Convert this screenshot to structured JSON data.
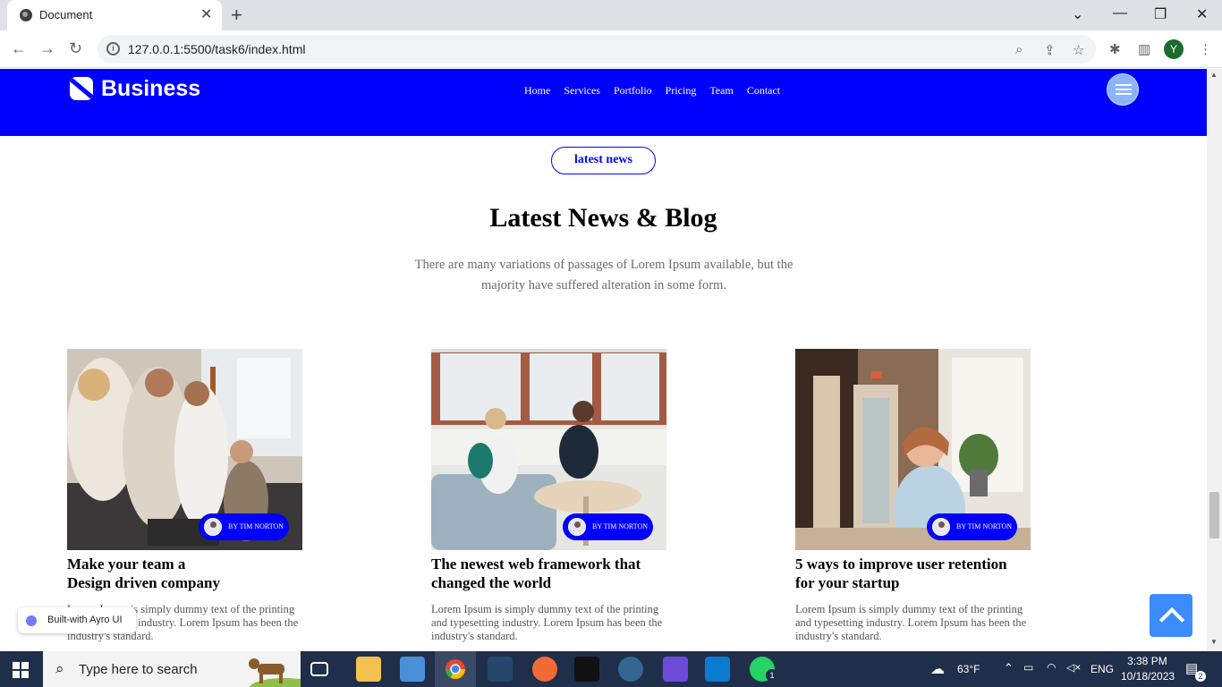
{
  "browser": {
    "tab_title": "Document",
    "url": "127.0.0.1:5500/task6/index.html",
    "profile_initial": "Y"
  },
  "site": {
    "logo": "Business",
    "nav": [
      "Home",
      "Services",
      "Portfolio",
      "Pricing",
      "Team",
      "Contact"
    ],
    "pill_label": "latest news",
    "section_title": "Latest News & Blog",
    "section_subtitle": "There are many variations of passages of Lorem Ipsum available, but the majority have suffered alteration in some form.",
    "cards": [
      {
        "title_line1": "Make your team a",
        "title_line2": "Design driven company",
        "author": "BY TIM NORTON",
        "excerpt": "Lorem Ipsum is simply dummy text of the printing and typesetting industry. Lorem Ipsum has been the industry's standard."
      },
      {
        "title_line1": "The newest web framework that",
        "title_line2": "changed the world",
        "author": "BY TIM NORTON",
        "excerpt": "Lorem Ipsum is simply dummy text of the printing and typesetting industry. Lorem Ipsum has been the industry's standard."
      },
      {
        "title_line1": "5 ways to improve user retention",
        "title_line2": "for your startup",
        "author": "BY TIM NORTON",
        "excerpt": "Lorem Ipsum is simply dummy text of the printing and typesetting industry. Lorem Ipsum has been the industry's standard."
      }
    ],
    "ayro_label": "Built-with Ayro UI"
  },
  "taskbar": {
    "search_placeholder": "Type here to search",
    "weather": "63°F",
    "language": "ENG",
    "time": "3:38 PM",
    "date": "10/18/2023",
    "notifications": "2",
    "whatsapp_badge": "1"
  },
  "colors": {
    "brand_blue": "#0000ff",
    "taskbar": "#1f2f4a"
  }
}
